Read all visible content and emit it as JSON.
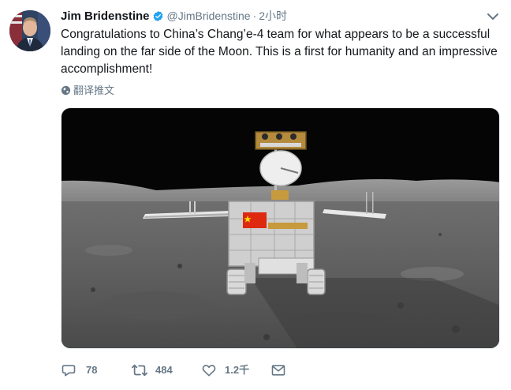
{
  "author": {
    "name": "Jim Bridenstine",
    "handle": "@JimBridenstine",
    "separator": "·",
    "time": "2小时"
  },
  "tweet": {
    "text": "Congratulations to China’s Chang’e-4 team for what appears to be a successful landing on the far side of the Moon. This is a first for humanity and an impressive accomplishment!",
    "translate_label": "翻译推文"
  },
  "stats": {
    "replies": "78",
    "retweets": "484",
    "likes": "1.2千"
  },
  "icons": {
    "verified": "verified-badge-icon",
    "caret": "chevron-down-icon",
    "translate": "globe-icon",
    "reply": "reply-icon",
    "retweet": "retweet-icon",
    "like": "heart-icon",
    "message": "envelope-icon"
  },
  "colors": {
    "verified_blue": "#1da1f2",
    "muted_text": "#657786",
    "primary_text": "#14171a"
  }
}
